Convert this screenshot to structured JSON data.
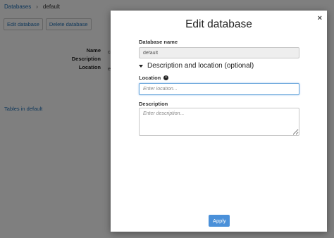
{
  "breadcrumb": {
    "root": "Databases",
    "separator": "›",
    "current": "default"
  },
  "toolbar": {
    "edit_label": "Edit database",
    "delete_label": "Delete database"
  },
  "properties": {
    "name_label": "Name",
    "name_value": "c",
    "description_label": "Description",
    "location_label": "Location",
    "location_value": "e"
  },
  "tables_link": "Tables in default",
  "modal": {
    "title": "Edit database",
    "close_icon": "×",
    "db_name_label": "Database name",
    "db_name_value": "default",
    "toggle_label": "Description and location (optional)",
    "location_label": "Location",
    "location_placeholder": "Enter location...",
    "description_label": "Description",
    "description_placeholder": "Enter description...",
    "apply_label": "Apply"
  },
  "colors": {
    "accent": "#4a90d9",
    "link": "#1f6fb5",
    "overlay": "rgba(0,0,0,0.5)"
  },
  "icons": {
    "close": "close-icon",
    "info": "info-icon",
    "caret": "caret-down-icon"
  }
}
